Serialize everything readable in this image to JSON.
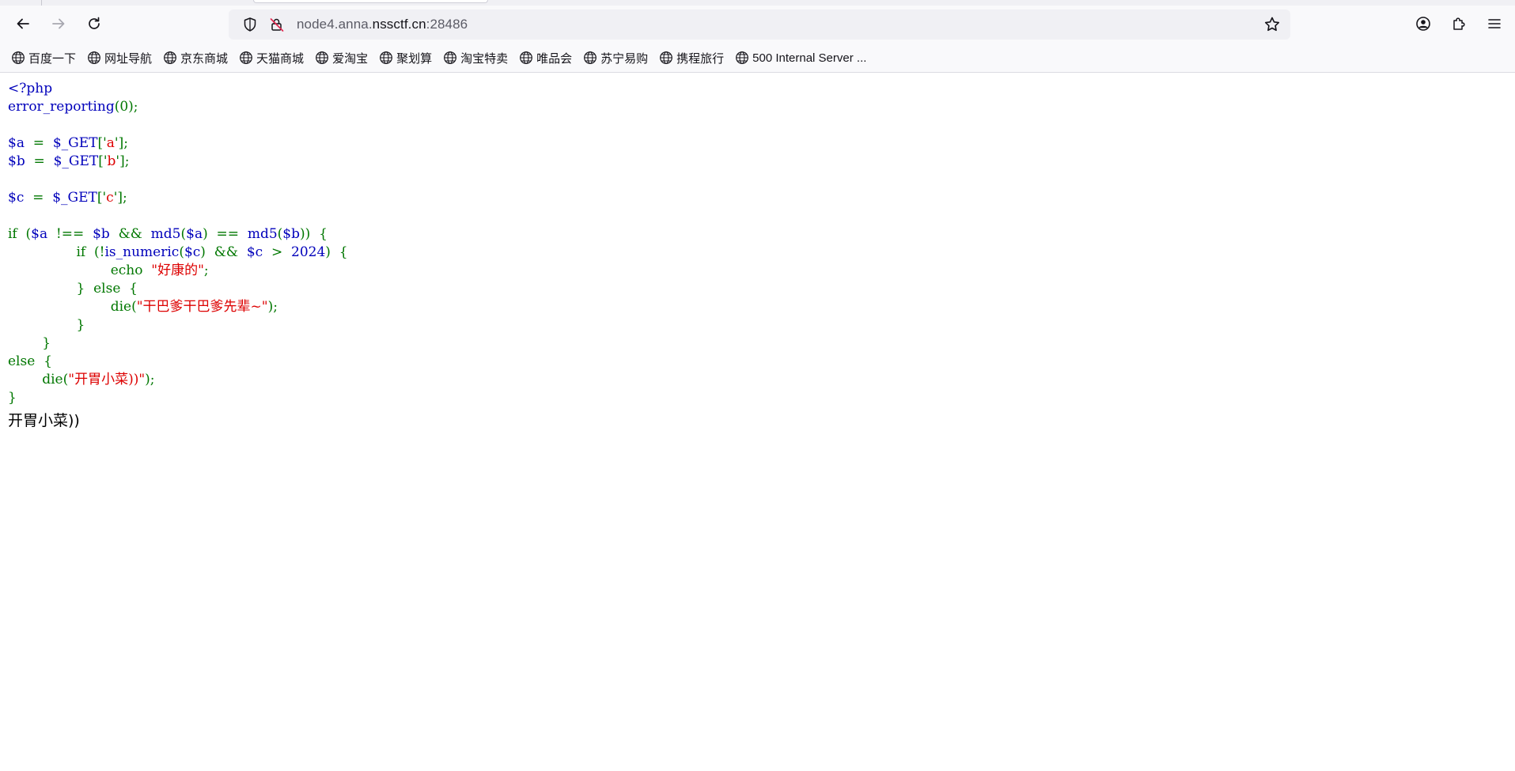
{
  "browser": {
    "url_scheme_host_prefix": "node4.anna.",
    "url_host": "nssctf.cn",
    "url_port": ":28486"
  },
  "bookmarks": [
    {
      "label": "百度一下"
    },
    {
      "label": "网址导航"
    },
    {
      "label": "京东商城"
    },
    {
      "label": "天猫商城"
    },
    {
      "label": "爱淘宝"
    },
    {
      "label": "聚划算"
    },
    {
      "label": "淘宝特卖"
    },
    {
      "label": "唯品会"
    },
    {
      "label": "苏宁易购"
    },
    {
      "label": "携程旅行"
    },
    {
      "label": "500 Internal Server ..."
    }
  ],
  "code": {
    "line1": "<?php",
    "line2_fn": "error_reporting",
    "line2_rest": "(0);",
    "a_var": "$a",
    "a_eq": "  =  ",
    "a_get": "$_GET",
    "a_open": "['",
    "a_key": "a",
    "a_close": "'];",
    "b_var": "$b",
    "b_get": "$_GET",
    "b_key": "b",
    "c_var": "$c",
    "c_get": "$_GET",
    "c_key": "c",
    "if1_kw": "if  (",
    "if1_a": "$a",
    "if1_op": "  !==  ",
    "if1_b": "$b",
    "if1_and": "  &&  ",
    "if1_md5a": "md5",
    "if1_pa1": "(",
    "if1_va": "$a",
    "if1_pa2": ")  ==  ",
    "if1_md5b": "md5",
    "if1_pb1": "(",
    "if1_vb": "$b",
    "if1_pb2": "))  {",
    "if2_kw": "if  (!",
    "if2_fn": "is_numeric",
    "if2_p1": "(",
    "if2_c": "$c",
    "if2_p2": ")  &&  ",
    "if2_c2": "$c",
    "if2_gt": "  >  ",
    "if2_num": "2024",
    "if2_end": ")  {",
    "echo_kw": "echo  ",
    "echo_str": "\"好康的\"",
    "echo_end": ";",
    "else1": "}  else  {",
    "die1_kw": "die(",
    "die1_str": "\"干巴爹干巴爹先辈~\"",
    "die1_end": ");",
    "close1": "}",
    "close2": "}",
    "else2": "else  {",
    "die2_kw": "die(",
    "die2_str": "\"开胃小菜))\"",
    "die2_end": ");",
    "close3": "}"
  },
  "output_text": "开胃小菜))"
}
